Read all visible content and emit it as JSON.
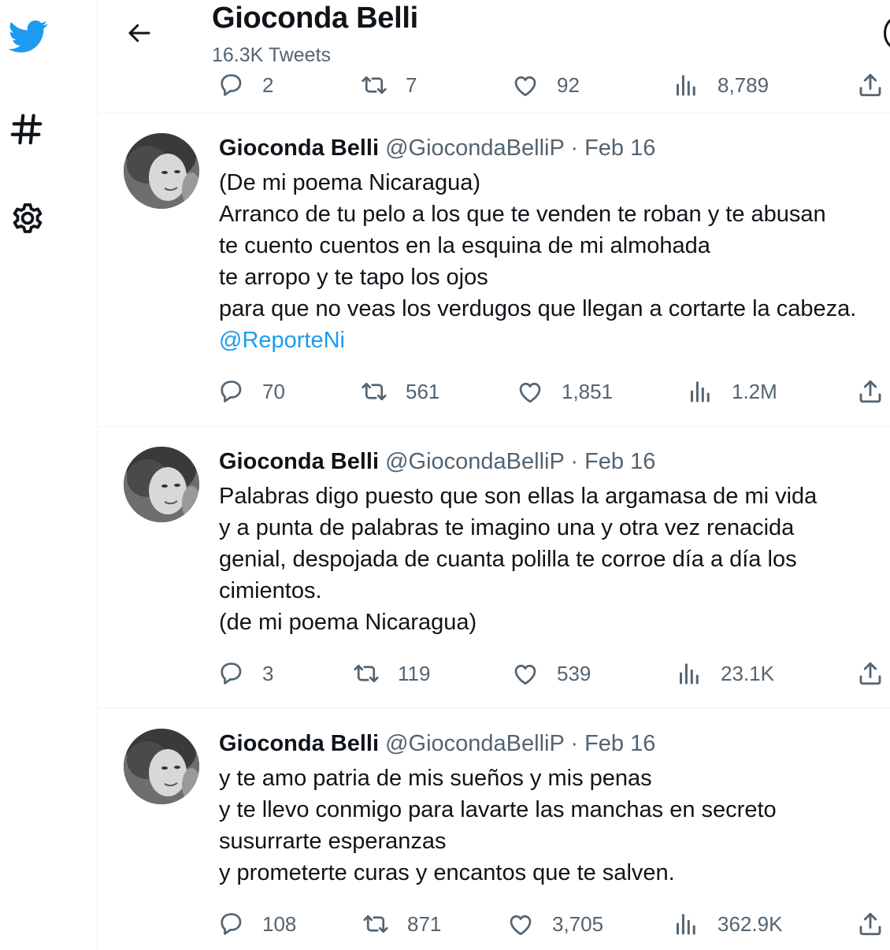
{
  "header": {
    "title": "Gioconda Belli",
    "subtitle": "16.3K Tweets"
  },
  "icons": {
    "brand": "twitter-bird-icon",
    "explore": "hashtag-icon",
    "settings": "gear-icon",
    "back": "back-arrow-icon"
  },
  "colors": {
    "accent": "#1d9bf0",
    "text": "#0f1419",
    "muted": "#536471",
    "divider": "#eff3f4"
  },
  "partial_tweet": {
    "replies": "2",
    "retweets": "7",
    "likes": "92",
    "views": "8,789"
  },
  "tweets": [
    {
      "name": "Gioconda Belli",
      "handle": "@GiocondaBelliP",
      "date": "Feb 16",
      "lines": [
        "(De mi poema Nicaragua)",
        "Arranco de tu pelo a los que te venden te roban y te abusan",
        "te cuento cuentos en la esquina de mi almohada",
        "te arropo y te tapo los ojos",
        "para que no veas los verdugos que llegan a cortarte la cabeza."
      ],
      "mention": "@ReporteNi",
      "replies": "70",
      "retweets": "561",
      "likes": "1,851",
      "views": "1.2M"
    },
    {
      "name": "Gioconda Belli",
      "handle": "@GiocondaBelliP",
      "date": "Feb 16",
      "lines": [
        "Palabras digo puesto que son ellas la argamasa de mi vida",
        "y a punta de palabras te imagino una y otra vez renacida",
        "genial, despojada de cuanta polilla te corroe día a día los",
        "cimientos.",
        "(de mi poema Nicaragua)"
      ],
      "replies": "3",
      "retweets": "119",
      "likes": "539",
      "views": "23.1K"
    },
    {
      "name": "Gioconda Belli",
      "handle": "@GiocondaBelliP",
      "date": "Feb 16",
      "lines": [
        "y te amo patria de mis sueños y mis penas",
        "y te llevo conmigo para lavarte las manchas en secreto",
        "susurrarte esperanzas",
        "y prometerte curas y encantos que te salven."
      ],
      "replies": "108",
      "retweets": "871",
      "likes": "3,705",
      "views": "362.9K"
    }
  ]
}
